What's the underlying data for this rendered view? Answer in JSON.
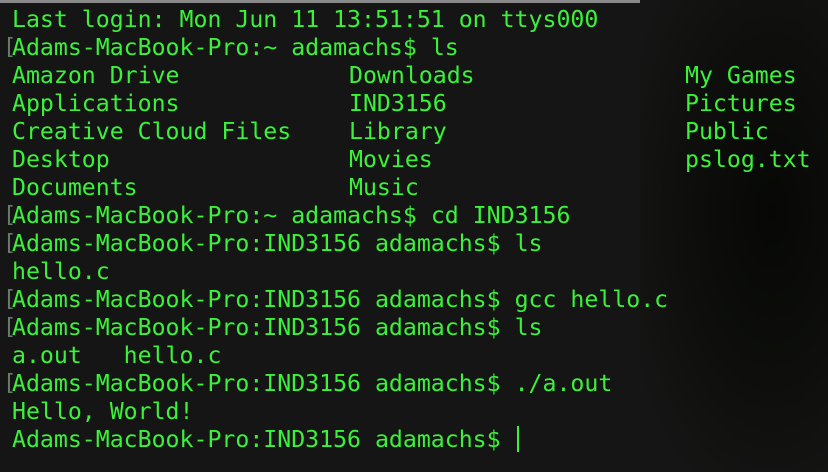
{
  "terminal": {
    "colors": {
      "text": "#3af23a",
      "background": "#151515"
    },
    "last_login": "Last login: Mon Jun 11 13:51:51 on ttys000",
    "prompt_marker": "[",
    "lines": [
      {
        "prompt": "Adams-MacBook-Pro:~ adamachs$ ",
        "command": "ls"
      },
      {
        "prompt": "Adams-MacBook-Pro:~ adamachs$ ",
        "command": "cd IND3156"
      },
      {
        "prompt": "Adams-MacBook-Pro:IND3156 adamachs$ ",
        "command": "ls"
      },
      {
        "prompt": "Adams-MacBook-Pro:IND3156 adamachs$ ",
        "command": "gcc hello.c"
      },
      {
        "prompt": "Adams-MacBook-Pro:IND3156 adamachs$ ",
        "command": "ls"
      },
      {
        "prompt": "Adams-MacBook-Pro:IND3156 adamachs$ ",
        "command": "./a.out"
      },
      {
        "prompt": "Adams-MacBook-Pro:IND3156 adamachs$ ",
        "command": ""
      }
    ],
    "ls_home": [
      [
        "Amazon Drive",
        "Downloads",
        "My Games"
      ],
      [
        "Applications",
        "IND3156",
        "Pictures"
      ],
      [
        "Creative Cloud Files",
        "Library",
        "Public"
      ],
      [
        "Desktop",
        "Movies",
        "pslog.txt"
      ],
      [
        "Documents",
        "Music",
        ""
      ]
    ],
    "ls_ind1": "hello.c",
    "ls_ind2": "a.out   hello.c",
    "program_output": "Hello, World!"
  }
}
